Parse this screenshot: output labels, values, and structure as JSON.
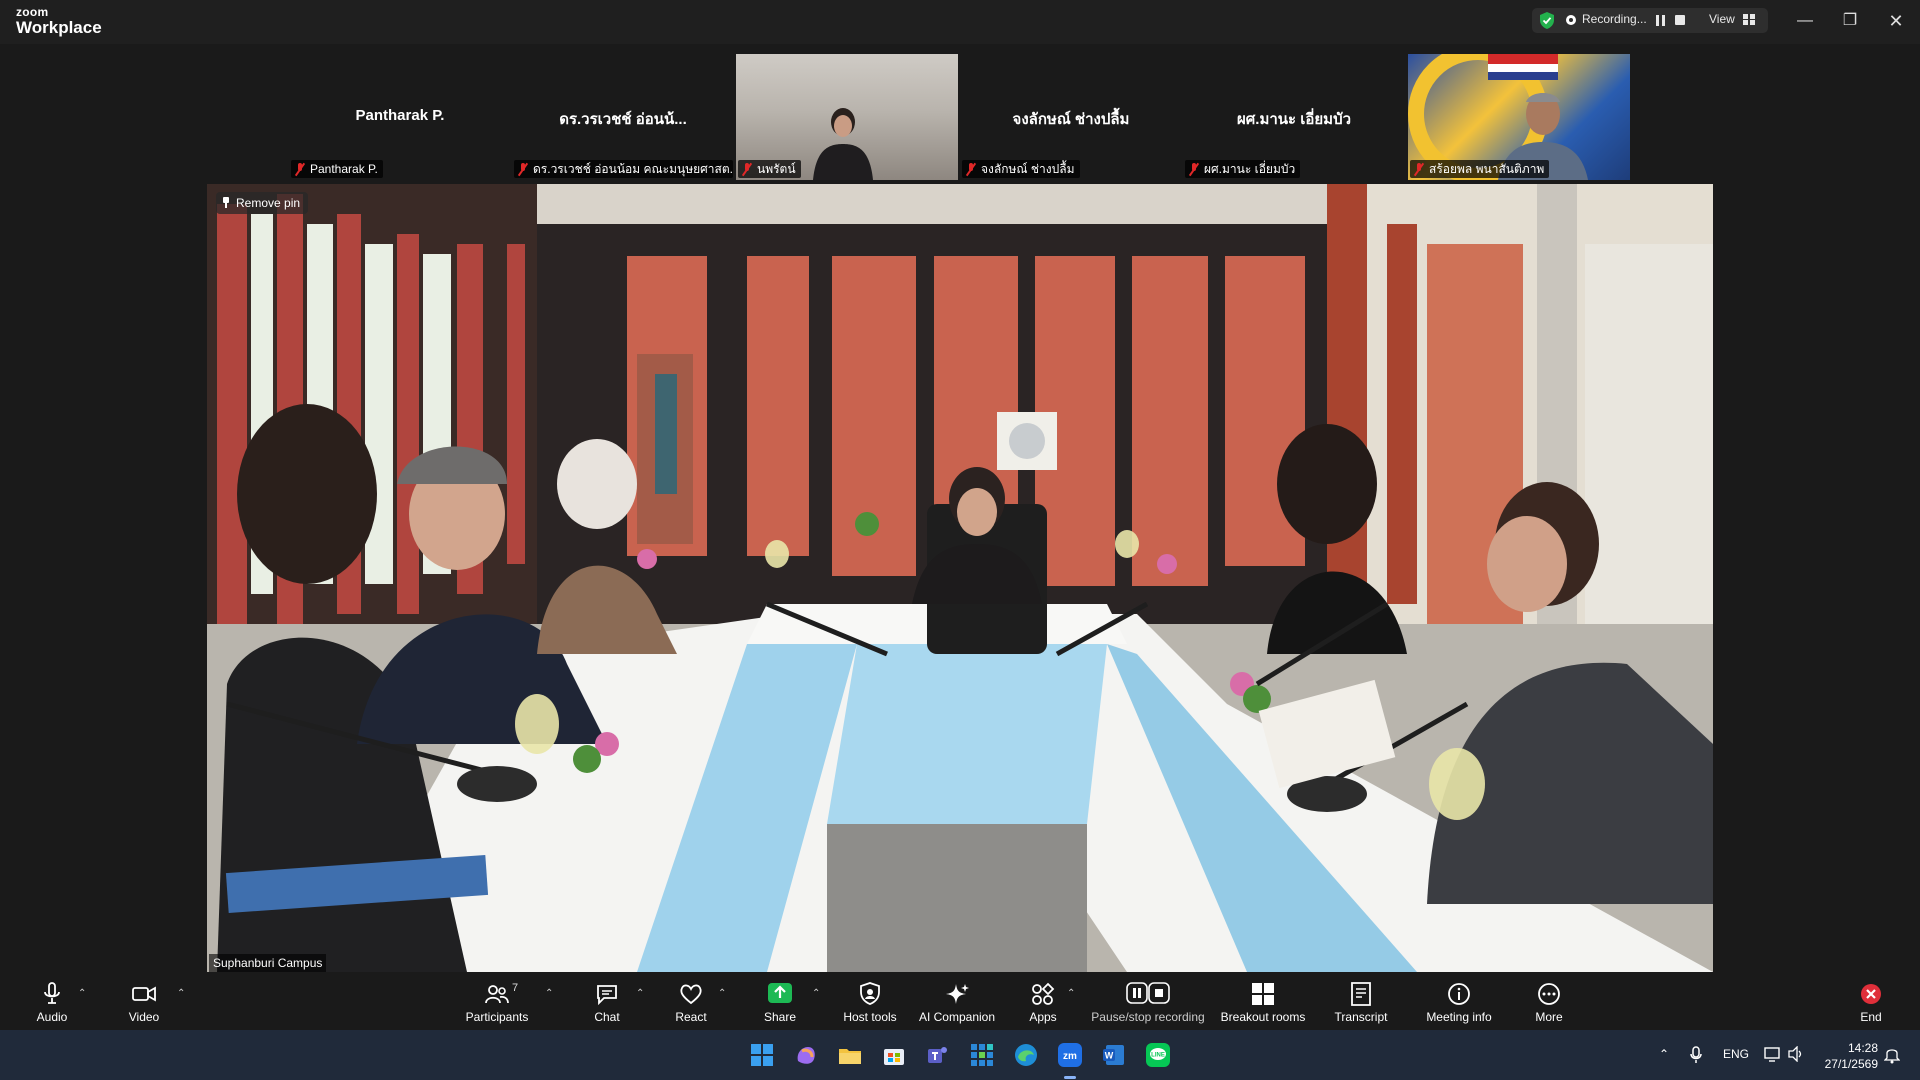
{
  "app": {
    "logo_top": "zoom",
    "logo_bottom": "Workplace"
  },
  "recording": {
    "label": "Recording...",
    "view_label": "View"
  },
  "window_controls": [
    "minimize",
    "restore",
    "close"
  ],
  "participants_strip": [
    {
      "display": "Pantharak P.",
      "tag": "Pantharak P.",
      "video": false
    },
    {
      "display": "ดร.วรเวชช์ อ่อนน้...",
      "tag": "ดร.วรเวชช์ อ่อนน้อม คณะมนุษยศาสต...",
      "video": false
    },
    {
      "display": "",
      "tag": "นพรัตน์",
      "video": true
    },
    {
      "display": "จงลักษณ์ ช่างปลื้ม",
      "tag": "จงลักษณ์ ช่างปลื้ม",
      "video": false
    },
    {
      "display": "ผศ.มานะ เอี่ยมบัว",
      "tag": "ผศ.มานะ เอี่ยมบัว",
      "video": false
    },
    {
      "display": "",
      "tag": "สร้อยพล พนาสันติภาพ",
      "video": true
    }
  ],
  "main_video": {
    "remove_pin": "Remove pin",
    "name_tag": "Suphanburi Campus"
  },
  "toolbar": {
    "audio": "Audio",
    "video": "Video",
    "participants": "Participants",
    "participants_count": "7",
    "chat": "Chat",
    "react": "React",
    "share": "Share",
    "host_tools": "Host tools",
    "ai_companion": "AI Companion",
    "apps": "Apps",
    "pause_stop": "Pause/stop recording",
    "breakout": "Breakout rooms",
    "transcript": "Transcript",
    "meeting_info": "Meeting info",
    "more": "More",
    "end": "End"
  },
  "taskbar": {
    "apps": [
      "windows-start",
      "copilot",
      "file-explorer",
      "microsoft-store",
      "teams",
      "office-grid",
      "edge",
      "zoom",
      "word",
      "line"
    ],
    "language": "ENG",
    "time": "14:28",
    "date": "27/1/2569"
  },
  "colors": {
    "share_green": "#1db954",
    "end_red": "#e02f3a",
    "mic_muted_red": "#e02828",
    "shield_green": "#23b14d"
  }
}
